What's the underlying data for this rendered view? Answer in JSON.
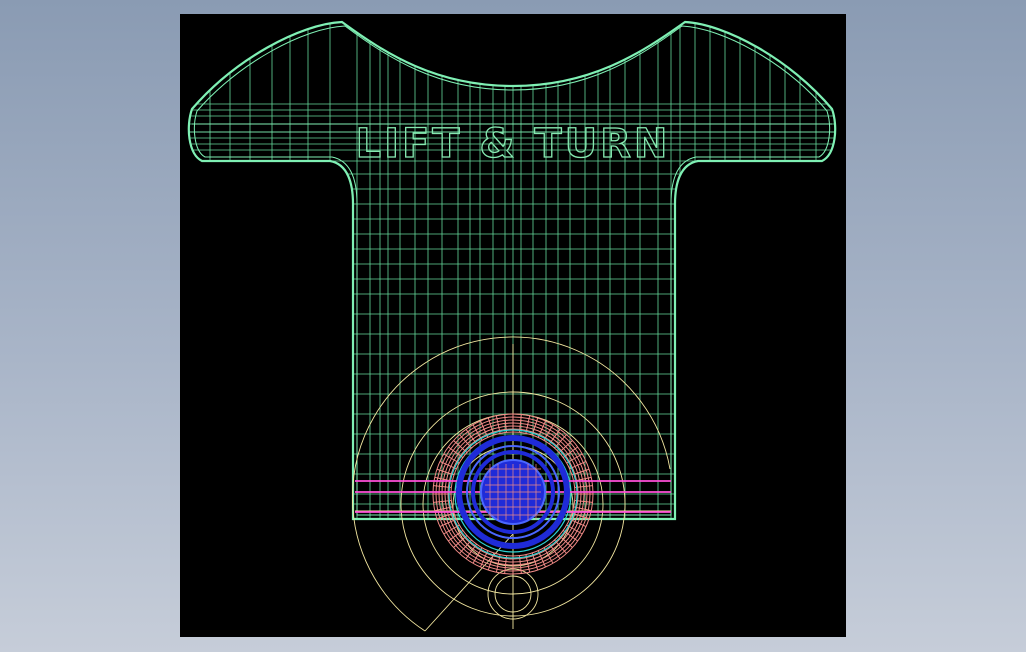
{
  "drawing": {
    "part_text": "LIFT & TURN",
    "colors": {
      "background": "#000000",
      "outline": "#7ff0b4",
      "hatch": "#64d89a",
      "construction": "#f3e7a0",
      "salmon": "#f08a86",
      "blue": "#1f2bd8",
      "blue_light": "#4a66ff",
      "magenta": "#ff4fd8",
      "cyan": "#2fd3d3"
    }
  }
}
